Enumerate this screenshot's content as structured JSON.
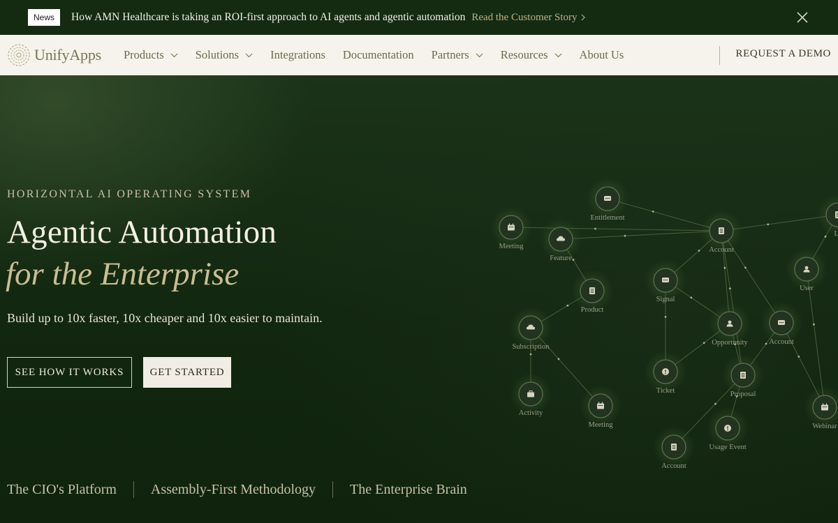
{
  "news": {
    "badge": "News",
    "text": "How AMN Healthcare is taking an ROI-first approach to AI agents and agentic automation",
    "link": "Read the Customer Story"
  },
  "nav": {
    "logo": "UnifyApps",
    "items": [
      {
        "label": "Products",
        "dropdown": true
      },
      {
        "label": "Solutions",
        "dropdown": true
      },
      {
        "label": "Integrations",
        "dropdown": false
      },
      {
        "label": "Documentation",
        "dropdown": false
      },
      {
        "label": "Partners",
        "dropdown": true
      },
      {
        "label": "Resources",
        "dropdown": true
      },
      {
        "label": "About Us",
        "dropdown": false
      }
    ],
    "cta": "REQUEST A DEMO"
  },
  "hero": {
    "eyebrow": "HORIZONTAL AI OPERATING SYSTEM",
    "headline_line1": "Agentic Automation",
    "headline_line2": "for the Enterprise",
    "subtext": "Build up to 10x faster, 10x cheaper and 10x easier to maintain.",
    "primary_button": "SEE HOW IT WORKS",
    "secondary_button": "GET STARTED"
  },
  "bottom_links": [
    "The CIO's Platform",
    "Assembly-First Methodology",
    "The Enterprise Brain"
  ],
  "graph": {
    "nodes": [
      {
        "label": "Entitlement",
        "icon": "chat"
      },
      {
        "label": "Meeting",
        "icon": "calendar"
      },
      {
        "label": "Feature",
        "icon": "cloud"
      },
      {
        "label": "Account",
        "icon": "doc"
      },
      {
        "label": "Le",
        "icon": "doc"
      },
      {
        "label": "User",
        "icon": "user"
      },
      {
        "label": "Signal",
        "icon": "chat"
      },
      {
        "label": "Product",
        "icon": "doc"
      },
      {
        "label": "Subscription",
        "icon": "cloud"
      },
      {
        "label": "Opportunity",
        "icon": "user"
      },
      {
        "label": "Account",
        "icon": "chat"
      },
      {
        "label": "Ticket",
        "icon": "alert"
      },
      {
        "label": "Proposal",
        "icon": "doc"
      },
      {
        "label": "Activity",
        "icon": "briefcase"
      },
      {
        "label": "Meeting",
        "icon": "calendar"
      },
      {
        "label": "Webinar",
        "icon": "calendar"
      },
      {
        "label": "Usage Event",
        "icon": "alert"
      },
      {
        "label": "Account",
        "icon": "doc"
      }
    ]
  },
  "colors": {
    "background": "#10240f",
    "nav_background": "#f6f3ec",
    "accent_gold": "#c9bd95",
    "news_link": "#b9b384"
  }
}
